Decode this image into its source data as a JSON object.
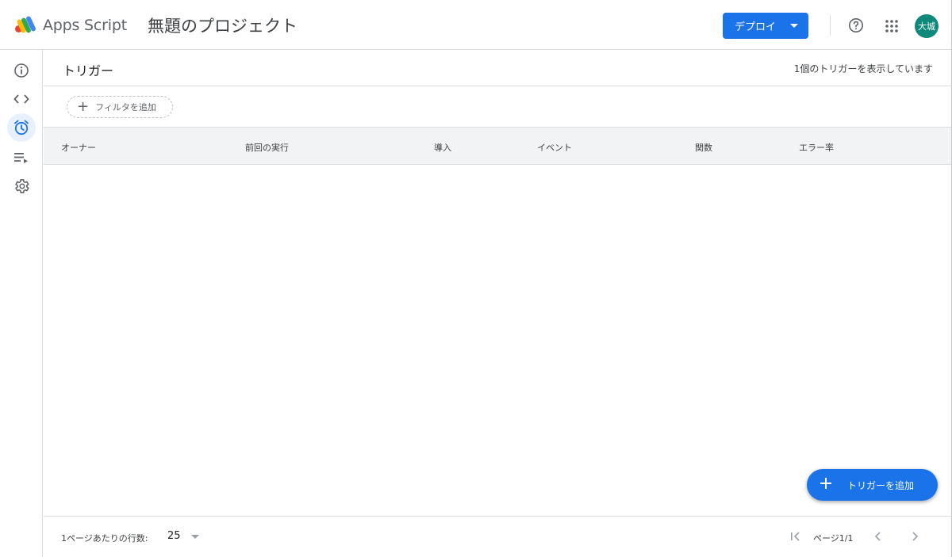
{
  "header": {
    "brand": "Apps Script",
    "project_title": "無題のプロジェクト",
    "deploy_label": "デプロイ",
    "avatar_text": "大城",
    "avatar_color": "#0f8a7a"
  },
  "sidebar": {
    "items": [
      {
        "icon": "info-icon",
        "name": "overview"
      },
      {
        "icon": "code-icon",
        "name": "editor"
      },
      {
        "icon": "alarm-clock-icon",
        "name": "triggers",
        "active": true
      },
      {
        "icon": "executions-icon",
        "name": "executions"
      },
      {
        "icon": "gear-icon",
        "name": "settings"
      }
    ]
  },
  "main": {
    "title": "トリガー",
    "count_text": "1個のトリガーを表示しています",
    "filter_label": "フィルタを追加",
    "columns": [
      "オーナー",
      "前回の実行",
      "導入",
      "イベント",
      "関数",
      "エラー率"
    ],
    "rows": []
  },
  "footer": {
    "rows_per_page_label": "1ページあたりの行数:",
    "rows_per_page_value": "25",
    "page_indicator": "ページ1/1"
  },
  "fab": {
    "label": "トリガーを追加"
  },
  "colors": {
    "accent": "#1a73e8",
    "active_nav_bg": "#e8f0fe",
    "table_header_bg": "#f1f3f4"
  }
}
